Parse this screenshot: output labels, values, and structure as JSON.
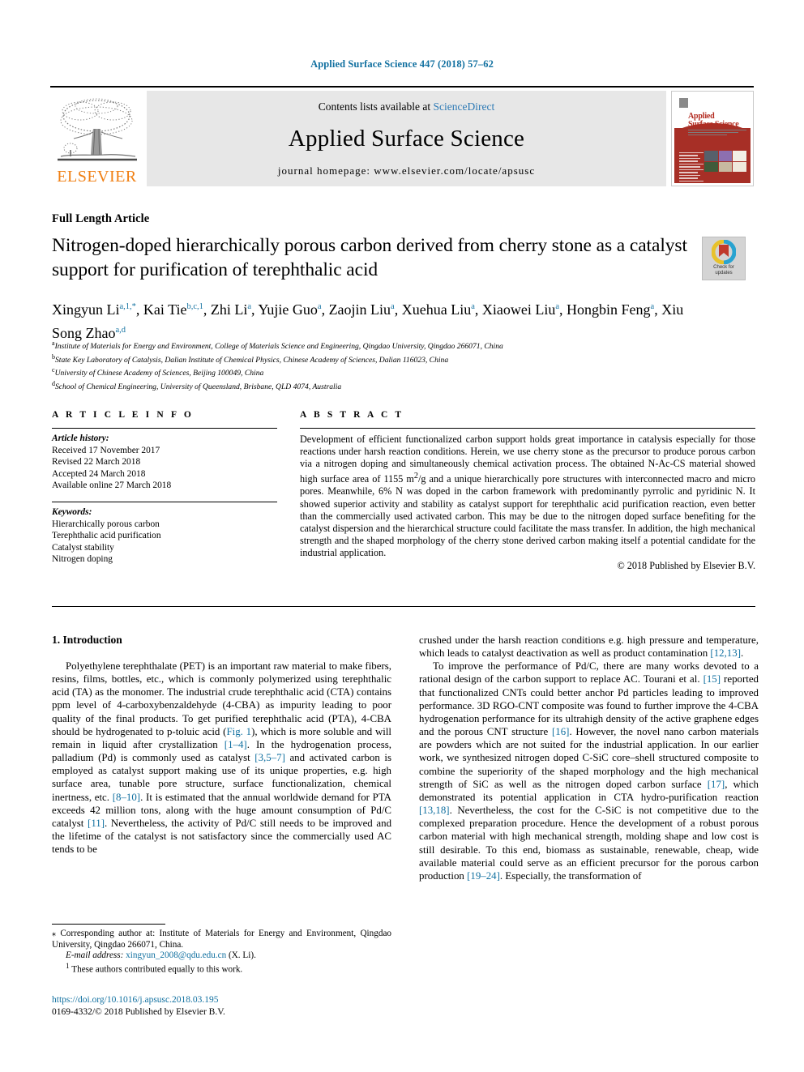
{
  "running_head": "Applied Surface Science 447 (2018) 57–62",
  "masthead": {
    "publisher_name": "ELSEVIER",
    "contents_prefix": "Contents lists available at ",
    "contents_link": "ScienceDirect",
    "journal_title": "Applied Surface Science",
    "homepage": "journal homepage: www.elsevier.com/locate/apsusc",
    "cover_title_line1": "Applied",
    "cover_title_line2": "Surface Science"
  },
  "article": {
    "type": "Full Length Article",
    "title_line1": "Nitrogen-doped hierarchically porous carbon derived from cherry stone",
    "title_line2": "as a catalyst support for purification of terephthalic acid",
    "crossmark_label": "Check for\nupdates"
  },
  "authors": {
    "list": [
      {
        "name": "Xingyun Li",
        "sup": "a,1,*"
      },
      {
        "name": "Kai Tie",
        "sup": "b,c,1"
      },
      {
        "name": "Zhi Li",
        "sup": "a"
      },
      {
        "name": "Yujie Guo",
        "sup": "a"
      },
      {
        "name": "Zaojin Liu",
        "sup": "a"
      },
      {
        "name": "Xuehua Liu",
        "sup": "a"
      },
      {
        "name": "Xiaowei Liu",
        "sup": "a"
      },
      {
        "name": "Hongbin Feng",
        "sup": "a"
      },
      {
        "name": "Xiu Song Zhao",
        "sup": "a,d"
      }
    ],
    "affiliations": [
      {
        "mark": "a",
        "text": "Institute of Materials for Energy and Environment, College of Materials Science and Engineering, Qingdao University, Qingdao 266071, China"
      },
      {
        "mark": "b",
        "text": "State Key Laboratory of Catalysis, Dalian Institute of Chemical Physics, Chinese Academy of Sciences, Dalian 116023, China"
      },
      {
        "mark": "c",
        "text": "University of Chinese Academy of Sciences, Beijing 100049, China"
      },
      {
        "mark": "d",
        "text": "School of Chemical Engineering, University of Queensland, Brisbane, QLD 4074, Australia"
      }
    ]
  },
  "article_info": {
    "heading": "A R T I C L E   I N F O",
    "history_label": "Article history:",
    "history": [
      "Received 17 November 2017",
      "Revised 22 March 2018",
      "Accepted 24 March 2018",
      "Available online 27 March 2018"
    ],
    "keywords_label": "Keywords:",
    "keywords": [
      "Hierarchically porous carbon",
      "Terephthalic acid purification",
      "Catalyst stability",
      "Nitrogen doping"
    ]
  },
  "abstract": {
    "heading": "A B S T R A C T",
    "text_part1": "Development of efficient functionalized carbon support holds great importance in catalysis especially for those reactions under harsh reaction conditions. Herein, we use cherry stone as the precursor to produce porous carbon via a nitrogen doping and simultaneously chemical activation process. The obtained N-Ac-CS material showed high surface area of 1155 m",
    "text_sup": "2",
    "text_part2": "/g and a unique hierarchically pore structures with interconnected macro and micro pores. Meanwhile, 6% N was doped in the carbon framework with predominantly pyrrolic and pyridinic N. It showed superior activity and stability as catalyst support for terephthalic acid purification reaction, even better than the commercially used activated carbon. This may be due to the nitrogen doped surface benefiting for the catalyst dispersion and the hierarchical structure could facilitate the mass transfer. In addition, the high mechanical strength and the shaped morphology of the cherry stone derived carbon making itself a potential candidate for the industrial application.",
    "copyright": "© 2018 Published by Elsevier B.V."
  },
  "body": {
    "section_heading": "1. Introduction",
    "left_p1_a": "Polyethylene terephthalate (PET) is an important raw material to make fibers, resins, films, bottles, etc., which is commonly polymerized using terephthalic acid (TA) as the monomer. The industrial crude terephthalic acid (CTA) contains ppm level of 4-carboxybenzaldehyde (4-CBA) as impurity leading to poor quality of the final products. To get purified terephthalic acid (PTA), 4-CBA should be hydrogenated to p-toluic acid (",
    "left_ref_fig1": "Fig. 1",
    "left_p1_b": "), which is more soluble and will remain in liquid after crystallization ",
    "left_ref_1_4": "[1–4]",
    "left_p1_c": ". In the hydrogenation process, palladium (Pd) is commonly used as catalyst ",
    "left_ref_3_5_7": "[3,5–7]",
    "left_p1_d": " and activated carbon is employed as catalyst support making use of its unique properties, e.g. high surface area, tunable pore structure, surface functionalization, chemical inertness, etc. ",
    "left_ref_8_10": "[8–10]",
    "left_p1_e": ". It is estimated that the annual worldwide demand for PTA exceeds 42 million tons, along with the huge amount consumption of Pd/C catalyst ",
    "left_ref_11": "[11]",
    "left_p1_f": ". Nevertheless, the activity of Pd/C still needs to be improved and the lifetime of the catalyst is not satisfactory since the commercially used AC tends to be",
    "right_p1_a": "crushed under the harsh reaction conditions e.g. high pressure and temperature, which leads to catalyst deactivation as well as product contamination ",
    "right_ref_12_13": "[12,13]",
    "right_p1_b": ".",
    "right_p2_a": "To improve the performance of Pd/C, there are many works devoted to a rational design of the carbon support to replace AC. Tourani et al. ",
    "right_ref_15": "[15]",
    "right_p2_b": " reported that functionalized CNTs could better anchor Pd particles leading to improved performance. 3D RGO-CNT composite was found to further improve the 4-CBA hydrogenation performance for its ultrahigh density of the active graphene edges and the porous CNT structure ",
    "right_ref_16": "[16]",
    "right_p2_c": ". However, the novel nano carbon materials are powders which are not suited for the industrial application. In our earlier work, we synthesized nitrogen doped C-SiC core–shell structured composite to combine the superiority of the shaped morphology and the high mechanical strength of SiC as well as the nitrogen doped carbon surface ",
    "right_ref_17": "[17]",
    "right_p2_d": ", which demonstrated its potential application in CTA hydro-purification reaction ",
    "right_ref_13_18": "[13,18]",
    "right_p2_e": ". Nevertheless, the cost for the C-SiC is not competitive due to the complexed preparation procedure. Hence the development of a robust porous carbon material with high mechanical strength, molding shape and low cost is still desirable. To this end, biomass as sustainable, renewable, cheap, wide available material could serve as an efficient precursor for the porous carbon production ",
    "right_ref_19_24": "[19–24]",
    "right_p2_f": ". Especially, the transformation of"
  },
  "footnotes": {
    "corresponding_mark": "⁎",
    "corresponding": " Corresponding author at: Institute of Materials for Energy and Environment, Qingdao University, Qingdao 266071, China.",
    "email_label": "E-mail address:",
    "email": "xingyun_2008@qdu.edu.cn",
    "email_suffix": " (X. Li).",
    "equal_mark": "1",
    "equal_text": " These authors contributed equally to this work."
  },
  "footer": {
    "doi": "https://doi.org/10.1016/j.apsusc.2018.03.195",
    "issn_line": "0169-4332/© 2018 Published by Elsevier B.V."
  },
  "colors": {
    "link_blue": "#1170a0",
    "sd_blue": "#2e7ab5",
    "elsevier_orange": "#f07f13",
    "cover_red": "#a72f26",
    "banner_gray": "#e7e7e7"
  }
}
